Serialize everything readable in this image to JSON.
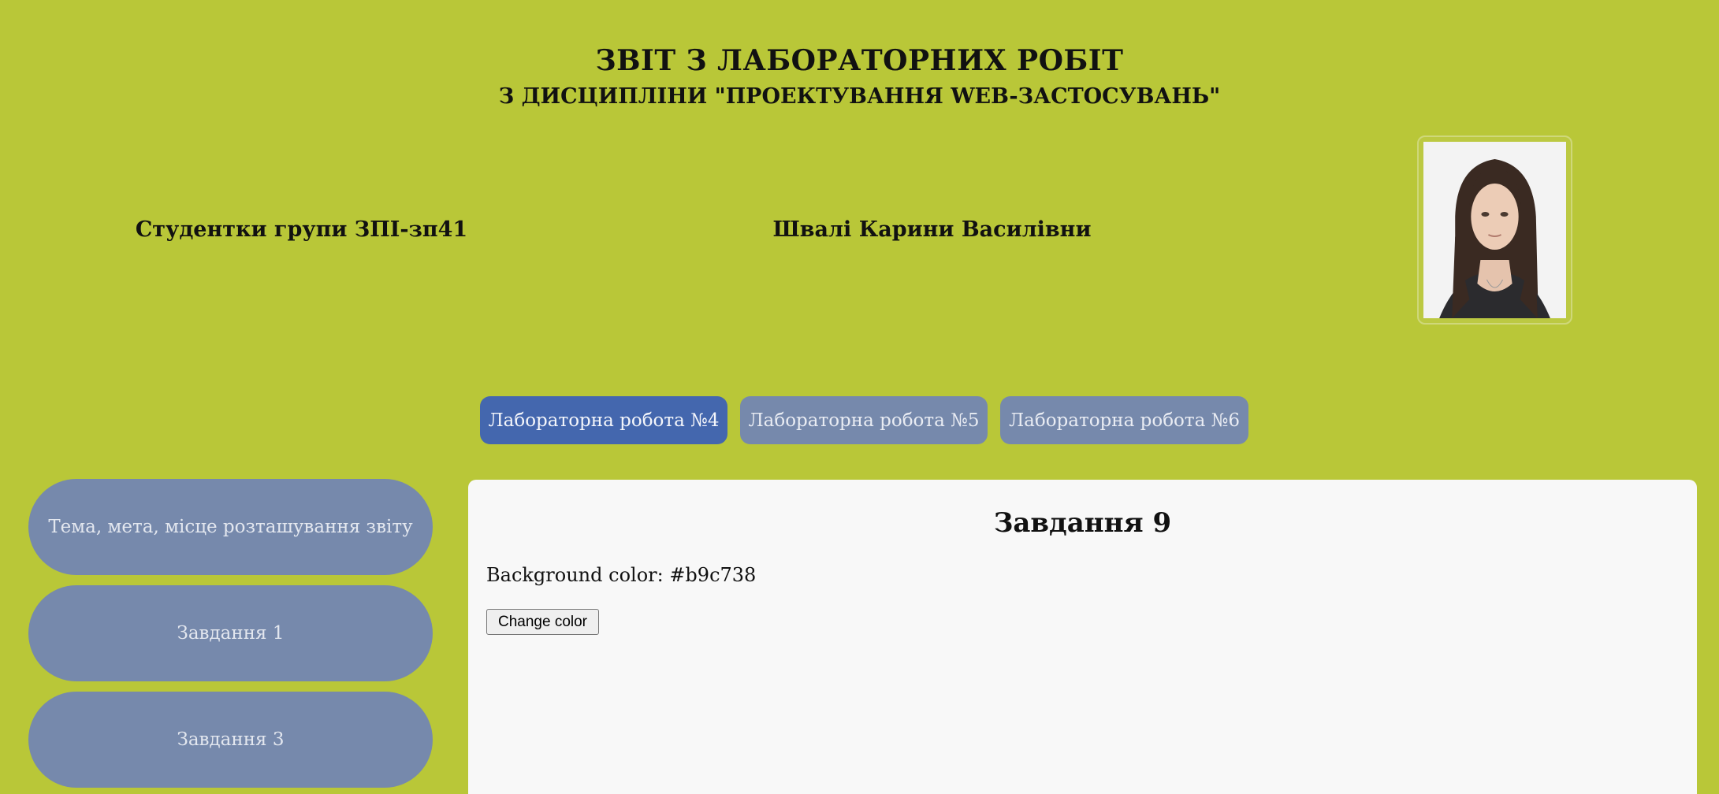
{
  "header": {
    "title": "ЗВІТ З ЛАБОРАТОРНИХ РОБІТ",
    "subtitle": "З ДИСЦИПЛІНИ \"ПРОЕКТУВАННЯ WEB-ЗАСТОСУВАНЬ\""
  },
  "student": {
    "group": "Студентки групи ЗПІ-зп41",
    "name": "Швалі Карини Василівни"
  },
  "tabs": [
    {
      "label": "Лабораторна робота №4",
      "active": true
    },
    {
      "label": "Лабораторна робота №5",
      "active": false
    },
    {
      "label": "Лабораторна робота №6",
      "active": false
    }
  ],
  "sidebar": {
    "items": [
      {
        "label": "Тема, мета, місце розташування звіту"
      },
      {
        "label": "Завдання 1"
      },
      {
        "label": "Завдання 3"
      }
    ]
  },
  "content": {
    "title": "Завдання 9",
    "background_text": "Background color: #b9c738",
    "button_label": "Change color"
  },
  "colors": {
    "page_background": "#b9c738",
    "tab_active": "#4467ae",
    "tab_inactive": "#7689ac",
    "content_background": "#f8f8f8"
  }
}
